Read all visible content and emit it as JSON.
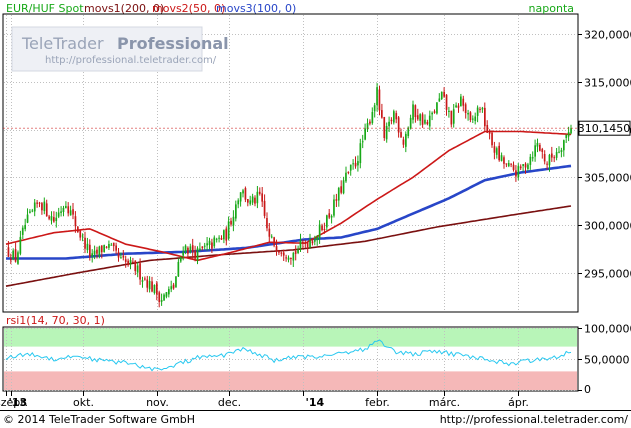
{
  "header": {
    "instrument": "EUR/HUF Spot",
    "movs1": "movs1(200, 0)",
    "movs2": "movs2(50, 0)",
    "movs3": "movs3(100, 0)",
    "period": "naponta"
  },
  "watermark": {
    "brand_light": "TeleTrader",
    "brand_bold": "Professional",
    "url": "http://professional.teletrader.com/"
  },
  "footer": {
    "copyright": "© 2014 TeleTrader Software GmbH",
    "url": "http://professional.teletrader.com/"
  },
  "colors": {
    "candle_up": "#18a818",
    "candle_down": "#c81818",
    "movs1": "#7a1010",
    "movs2": "#cc1818",
    "movs3": "#2846c8",
    "rsi_line": "#28c8f0",
    "rsi_overbought": "#b8f5b8",
    "rsi_oversold": "#f5b8b8",
    "last_price_line": "#cc1818"
  },
  "chart_data": [
    {
      "type": "candlestick",
      "title": "EUR/HUF Spot",
      "frequency": "naponta",
      "x_ticks": [
        {
          "label": "'13",
          "major": true,
          "day": 0
        },
        {
          "label": "szept.",
          "major": false,
          "day": 2
        },
        {
          "label": "okt.",
          "major": false,
          "day": 32
        },
        {
          "label": "nov.",
          "major": false,
          "day": 63
        },
        {
          "label": "dec.",
          "major": false,
          "day": 93
        },
        {
          "label": "'14",
          "major": true,
          "day": 124
        },
        {
          "label": "febr.",
          "major": false,
          "day": 155
        },
        {
          "label": "márc.",
          "major": false,
          "day": 183
        },
        {
          "label": "ápr.",
          "major": false,
          "day": 214
        }
      ],
      "x_range": [
        0,
        236
      ],
      "ylim": [
        291000,
        322000
      ],
      "y_ticks": [
        "295,0000",
        "300,0000",
        "305,0000",
        "310,0000",
        "315,0000",
        "320,0000"
      ],
      "y_tick_values": [
        295000,
        300000,
        305000,
        310000,
        315000,
        320000
      ],
      "last_value": 310145,
      "last_value_label": "310,1450",
      "close_anchors": [
        [
          0,
          297500
        ],
        [
          4,
          296500
        ],
        [
          8,
          300000
        ],
        [
          14,
          302500
        ],
        [
          20,
          300500
        ],
        [
          25,
          302500
        ],
        [
          30,
          299500
        ],
        [
          36,
          296500
        ],
        [
          42,
          298000
        ],
        [
          48,
          296200
        ],
        [
          54,
          295500
        ],
        [
          60,
          293800
        ],
        [
          65,
          292300
        ],
        [
          70,
          293500
        ],
        [
          74,
          297800
        ],
        [
          80,
          297000
        ],
        [
          86,
          298000
        ],
        [
          92,
          299000
        ],
        [
          98,
          303800
        ],
        [
          102,
          302200
        ],
        [
          106,
          303000
        ],
        [
          110,
          298500
        ],
        [
          115,
          297500
        ],
        [
          120,
          297000
        ],
        [
          124,
          298000
        ],
        [
          130,
          299000
        ],
        [
          136,
          301500
        ],
        [
          142,
          305000
        ],
        [
          146,
          306500
        ],
        [
          150,
          309500
        ],
        [
          155,
          313800
        ],
        [
          158,
          309000
        ],
        [
          162,
          311800
        ],
        [
          166,
          308800
        ],
        [
          170,
          312000
        ],
        [
          176,
          310500
        ],
        [
          182,
          313500
        ],
        [
          186,
          311000
        ],
        [
          190,
          313200
        ],
        [
          194,
          310500
        ],
        [
          198,
          312500
        ],
        [
          202,
          309000
        ],
        [
          206,
          307000
        ],
        [
          210,
          306000
        ],
        [
          214,
          305500
        ],
        [
          218,
          306800
        ],
        [
          222,
          308500
        ],
        [
          226,
          306500
        ],
        [
          230,
          307800
        ],
        [
          232,
          308500
        ],
        [
          234,
          309300
        ],
        [
          236,
          310145
        ]
      ],
      "series": [
        {
          "name": "movs1(200, 0)",
          "anchors": [
            [
              0,
              293600
            ],
            [
              30,
              295000
            ],
            [
              60,
              296300
            ],
            [
              90,
              296900
            ],
            [
              120,
              297400
            ],
            [
              150,
              298300
            ],
            [
              180,
              299800
            ],
            [
              210,
              301000
            ],
            [
              236,
              302000
            ]
          ]
        },
        {
          "name": "movs2(50, 0)",
          "anchors": [
            [
              0,
              298000
            ],
            [
              20,
              299200
            ],
            [
              35,
              299600
            ],
            [
              50,
              298000
            ],
            [
              65,
              297200
            ],
            [
              80,
              296300
            ],
            [
              95,
              297200
            ],
            [
              110,
              298200
            ],
            [
              125,
              298100
            ],
            [
              140,
              300200
            ],
            [
              155,
              302700
            ],
            [
              170,
              305000
            ],
            [
              185,
              307800
            ],
            [
              200,
              309800
            ],
            [
              215,
              309800
            ],
            [
              236,
              309500
            ]
          ]
        },
        {
          "name": "movs3(100, 0)",
          "anchors": [
            [
              0,
              296500
            ],
            [
              25,
              296500
            ],
            [
              50,
              297000
            ],
            [
              75,
              297200
            ],
            [
              100,
              297600
            ],
            [
              125,
              298500
            ],
            [
              140,
              298700
            ],
            [
              155,
              299600
            ],
            [
              170,
              301200
            ],
            [
              185,
              302800
            ],
            [
              200,
              304700
            ],
            [
              215,
              305500
            ],
            [
              236,
              306200
            ]
          ]
        }
      ]
    },
    {
      "type": "line",
      "title": "rsi1(14, 70, 30, 1)",
      "ylim": [
        0,
        100
      ],
      "y_ticks": [
        "0",
        "50,0000",
        "100,0000"
      ],
      "y_tick_values": [
        0,
        50,
        100
      ],
      "overbought": 70,
      "oversold": 30,
      "series": [
        {
          "name": "rsi1(14, 70, 30, 1)",
          "anchors": [
            [
              0,
              52
            ],
            [
              10,
              58
            ],
            [
              20,
              50
            ],
            [
              30,
              55
            ],
            [
              40,
              47
            ],
            [
              50,
              44
            ],
            [
              60,
              35
            ],
            [
              66,
              32
            ],
            [
              72,
              42
            ],
            [
              80,
              52
            ],
            [
              90,
              55
            ],
            [
              98,
              66
            ],
            [
              104,
              60
            ],
            [
              112,
              48
            ],
            [
              120,
              52
            ],
            [
              130,
              54
            ],
            [
              140,
              60
            ],
            [
              150,
              66
            ],
            [
              156,
              80
            ],
            [
              162,
              62
            ],
            [
              170,
              58
            ],
            [
              180,
              62
            ],
            [
              190,
              56
            ],
            [
              200,
              50
            ],
            [
              210,
              42
            ],
            [
              220,
              48
            ],
            [
              230,
              54
            ],
            [
              236,
              62
            ]
          ]
        }
      ]
    }
  ]
}
